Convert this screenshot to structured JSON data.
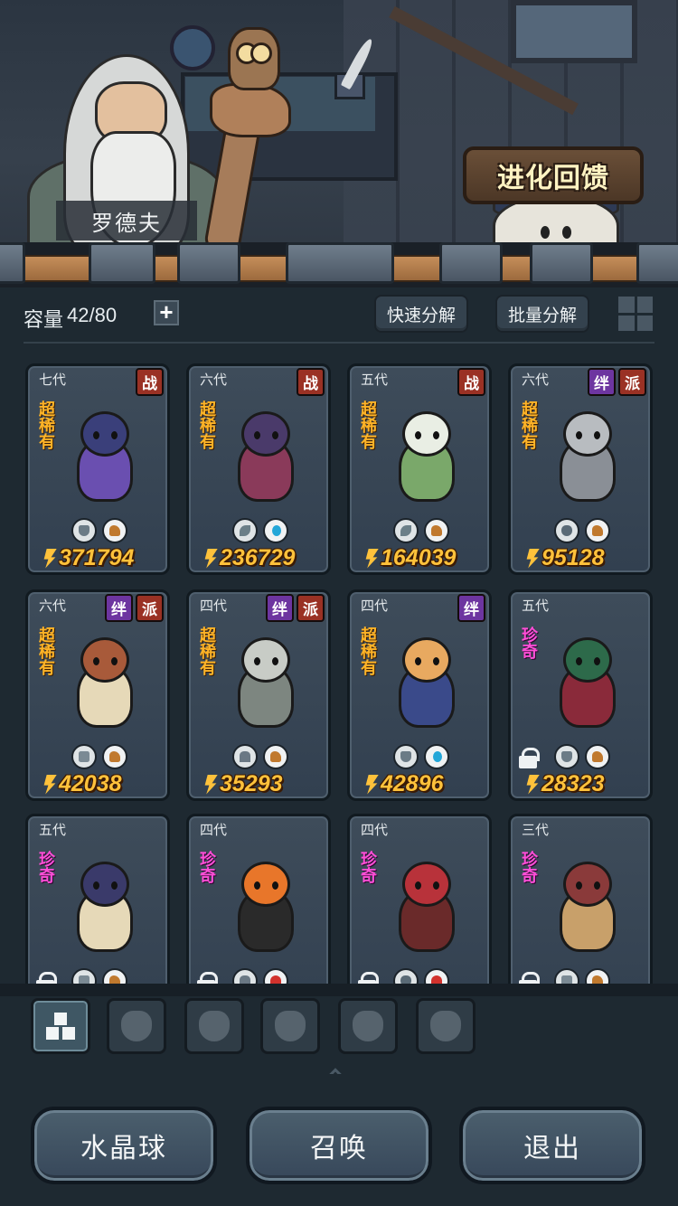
{
  "header": {
    "npc_name": "罗德夫",
    "evolve_feedback_label": "进化回馈"
  },
  "toolbar": {
    "capacity_label": "容量",
    "capacity_value": "42/80",
    "add_label": "+",
    "quick_decompose_label": "快速分解",
    "batch_decompose_label": "批量分解"
  },
  "cards": [
    {
      "gen": "七代",
      "tags": [
        "战"
      ],
      "rarity": "超稀有",
      "class_icon": "shield-icon",
      "element_icon": "earth-icon",
      "power": "371794",
      "locked": false
    },
    {
      "gen": "六代",
      "tags": [
        "战"
      ],
      "rarity": "超稀有",
      "class_icon": "plant-icon",
      "element_icon": "water-icon",
      "power": "236729",
      "locked": false
    },
    {
      "gen": "五代",
      "tags": [
        "战"
      ],
      "rarity": "超稀有",
      "class_icon": "plant-icon",
      "element_icon": "earth-icon",
      "power": "164039",
      "locked": false
    },
    {
      "gen": "六代",
      "tags": [
        "绊",
        "派"
      ],
      "rarity": "超稀有",
      "class_icon": "alien-icon",
      "element_icon": "earth-icon",
      "power": "95128",
      "locked": false
    },
    {
      "gen": "六代",
      "tags": [
        "绊",
        "派"
      ],
      "rarity": "超稀有",
      "class_icon": "fist-icon",
      "element_icon": "earth-icon",
      "power": "42038",
      "locked": false
    },
    {
      "gen": "四代",
      "tags": [
        "绊",
        "派"
      ],
      "rarity": "超稀有",
      "class_icon": "tower-icon",
      "element_icon": "earth-icon",
      "power": "35293",
      "locked": false
    },
    {
      "gen": "四代",
      "tags": [
        "绊"
      ],
      "rarity": "超稀有",
      "class_icon": "shield-icon",
      "element_icon": "water-icon",
      "power": "42896",
      "locked": false
    },
    {
      "gen": "五代",
      "tags": [],
      "rarity": "珍奇",
      "class_icon": "shield-icon",
      "element_icon": "earth-icon",
      "power": "28323",
      "locked": true
    },
    {
      "gen": "五代",
      "tags": [],
      "rarity": "珍奇",
      "class_icon": "fist-icon",
      "element_icon": "earth-icon",
      "power": "",
      "locked": true
    },
    {
      "gen": "四代",
      "tags": [],
      "rarity": "珍奇",
      "class_icon": "tower-icon",
      "element_icon": "fire-icon",
      "power": "",
      "locked": true
    },
    {
      "gen": "四代",
      "tags": [],
      "rarity": "珍奇",
      "class_icon": "alien-icon",
      "element_icon": "fire-icon",
      "power": "",
      "locked": true
    },
    {
      "gen": "三代",
      "tags": [],
      "rarity": "珍奇",
      "class_icon": "fist-icon",
      "element_icon": "earth-icon",
      "power": "",
      "locked": true
    }
  ],
  "filters": [
    {
      "icon": "all-blocks-icon",
      "active": true
    },
    {
      "icon": "fist-icon",
      "active": false
    },
    {
      "icon": "shield-wings-icon",
      "active": false
    },
    {
      "icon": "sprout-icon",
      "active": false
    },
    {
      "icon": "alien-icon",
      "active": false
    },
    {
      "icon": "tower-icon",
      "active": false
    }
  ],
  "bottom": {
    "crystal_ball_label": "水晶球",
    "summon_label": "召唤",
    "exit_label": "退出"
  },
  "colors": {
    "super_rare": "#ffb427",
    "rare": "#ff4fd8",
    "power": "#ffc23b",
    "tag_battle": "#9a3124",
    "tag_bond": "#6d35a0"
  }
}
